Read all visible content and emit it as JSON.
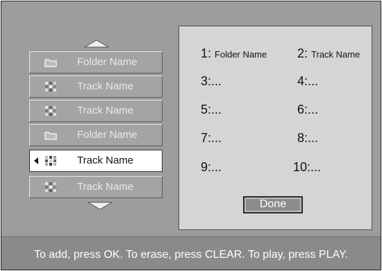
{
  "browser": {
    "items": [
      {
        "type": "folder",
        "icon": "folder-icon",
        "label": "Folder Name",
        "selected": false
      },
      {
        "type": "track",
        "icon": "track-icon",
        "label": "Track Name",
        "selected": false
      },
      {
        "type": "track",
        "icon": "track-icon",
        "label": "Track Name",
        "selected": false
      },
      {
        "type": "folder",
        "icon": "folder-icon",
        "label": "Folder Name",
        "selected": false
      },
      {
        "type": "track",
        "icon": "track-icon",
        "label": "Track Name",
        "selected": true
      },
      {
        "type": "track",
        "icon": "track-icon",
        "label": "Track Name",
        "selected": false
      }
    ],
    "scroll_up_icon": "chevron-up-icon",
    "scroll_down_icon": "chevron-down-icon",
    "pointer_icon": "pointer-left-icon"
  },
  "program": {
    "slots": [
      {
        "number": "1:",
        "name": "Folder Name"
      },
      {
        "number": "2:",
        "name": "Track Name"
      },
      {
        "number": "3:",
        "name": "..."
      },
      {
        "number": "4:",
        "name": "..."
      },
      {
        "number": "5:",
        "name": "..."
      },
      {
        "number": "6:",
        "name": "..."
      },
      {
        "number": "7:",
        "name": "..."
      },
      {
        "number": "8:",
        "name": "..."
      },
      {
        "number": "9:",
        "name": "..."
      },
      {
        "number": "10:",
        "name": "..."
      }
    ],
    "done_label": "Done"
  },
  "footer": {
    "hint": "To add, press OK. To erase, press CLEAR. To play, press PLAY."
  }
}
